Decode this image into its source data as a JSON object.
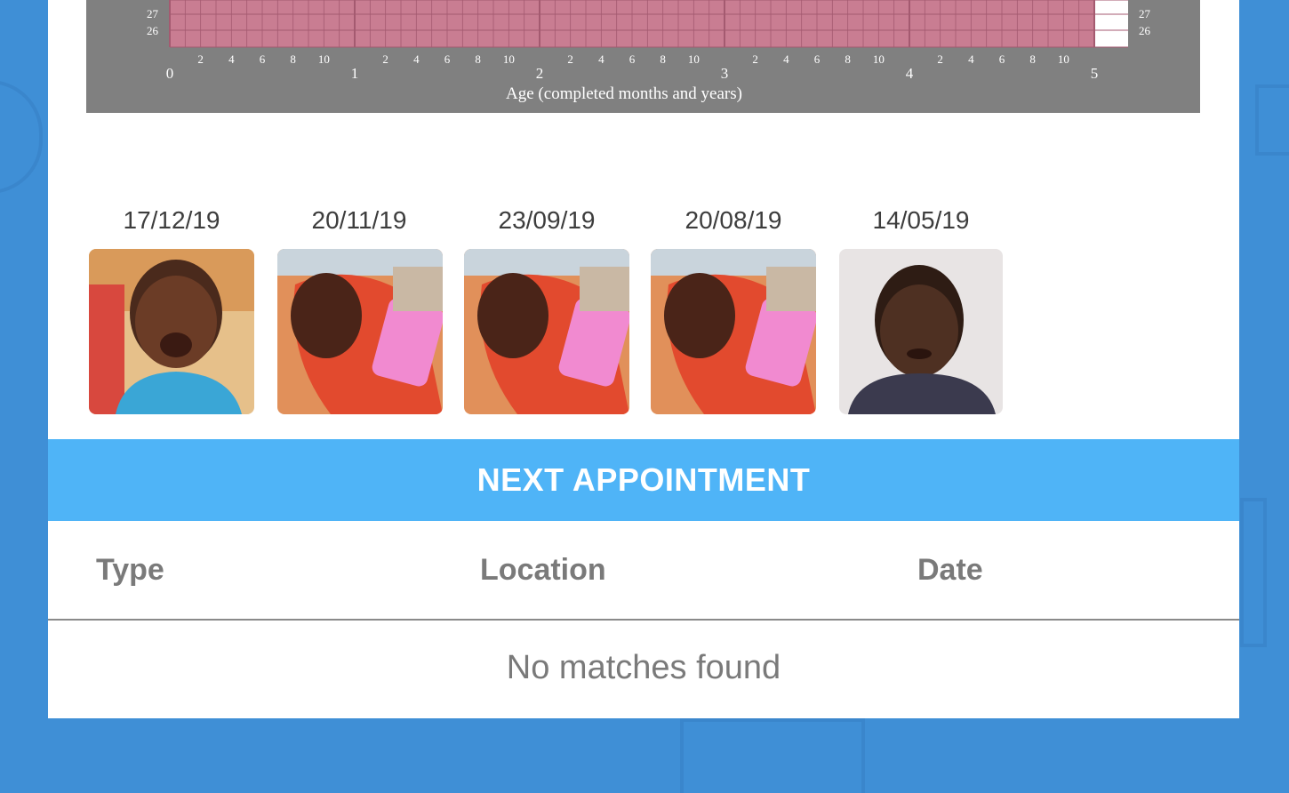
{
  "growth_chart": {
    "y_ticks_left": [
      "27",
      "26"
    ],
    "y_ticks_right": [
      "27",
      "26"
    ],
    "month_ticks": [
      "2",
      "4",
      "6",
      "8",
      "10"
    ],
    "year_ticks": [
      "0",
      "1",
      "2",
      "3",
      "4",
      "5"
    ],
    "x_axis_label": "Age (completed months and years)",
    "colors": {
      "panel": "#808080",
      "fill": "#c97d92",
      "grid": "#a45a70",
      "label": "#ffffff"
    }
  },
  "photos": [
    {
      "date": "17/12/19",
      "icon": "child-photo-smiling"
    },
    {
      "date": "20/11/19",
      "icon": "child-photo-with-cup"
    },
    {
      "date": "23/09/19",
      "icon": "child-photo-with-cup"
    },
    {
      "date": "20/08/19",
      "icon": "child-photo-with-cup"
    },
    {
      "date": "14/05/19",
      "icon": "child-photo-portrait"
    }
  ],
  "appointment": {
    "title": "NEXT APPOINTMENT",
    "columns": [
      "Type",
      "Location",
      "Date"
    ],
    "empty_message": "No matches found"
  },
  "colors": {
    "background": "#3f8fd6",
    "header": "#4fb4f7",
    "text": "#7a7a7a"
  }
}
